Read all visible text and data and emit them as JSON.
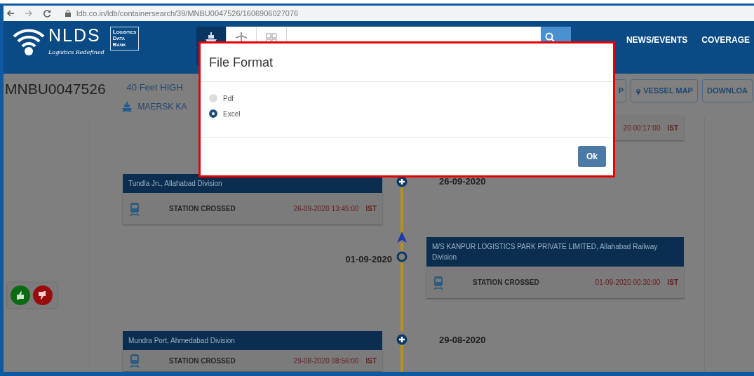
{
  "browser": {
    "url": "ldb.co.in/ldb/containersearch/39/MNBU0047526/1606906027076"
  },
  "header": {
    "logo_text": "NLDS",
    "logo_tagline": "Logistics Redefined",
    "ldb_lines": [
      "Logistics",
      "Data",
      "Bank"
    ],
    "mode_tabs": [
      {
        "kind": "ship",
        "selected": true
      },
      {
        "kind": "plane",
        "selected": false
      },
      {
        "kind": "grid",
        "selected": false
      }
    ],
    "nav_links": [
      "NEWS/EVENTS",
      "COVERAGE"
    ]
  },
  "container": {
    "number": "MNBU0047526",
    "type": "40 Feet HIGH",
    "vessel": "MAERSK KA",
    "buttons": [
      {
        "label": "P",
        "kind": "plain"
      },
      {
        "label": "VESSEL MAP",
        "kind": "pin"
      },
      {
        "label": "DOWNLOA",
        "kind": "plain"
      }
    ]
  },
  "timeline": [
    {
      "kind": "partial",
      "time": "20 00:17:00",
      "zone": "IST"
    },
    {
      "kind": "plus",
      "date": "26-09-2020",
      "place": "Tundla Jn., Allahabad Division",
      "event": "STATION CROSSED",
      "time": "26-09-2020 13:45:00",
      "zone": "IST"
    },
    {
      "kind": "circle",
      "date": "01-09-2020",
      "place": "M/S KANPUR LOGISTICS PARK PRIVATE LIMITED, Allahabad Railway Division",
      "event": "STATION CROSSED",
      "time": "01-09-2020 00:30:00",
      "zone": "IST"
    },
    {
      "kind": "plus",
      "date": "29-08-2020",
      "place": "Mundra Port, Ahmedabad Division",
      "event": "STATION CROSSED",
      "time": "29-08-2020 08:56:00",
      "zone": "IST"
    }
  ],
  "dialog": {
    "title": "File Format",
    "options": [
      {
        "label": "Pdf",
        "selected": false
      },
      {
        "label": "Excel",
        "selected": true
      }
    ],
    "button": "Ok"
  }
}
